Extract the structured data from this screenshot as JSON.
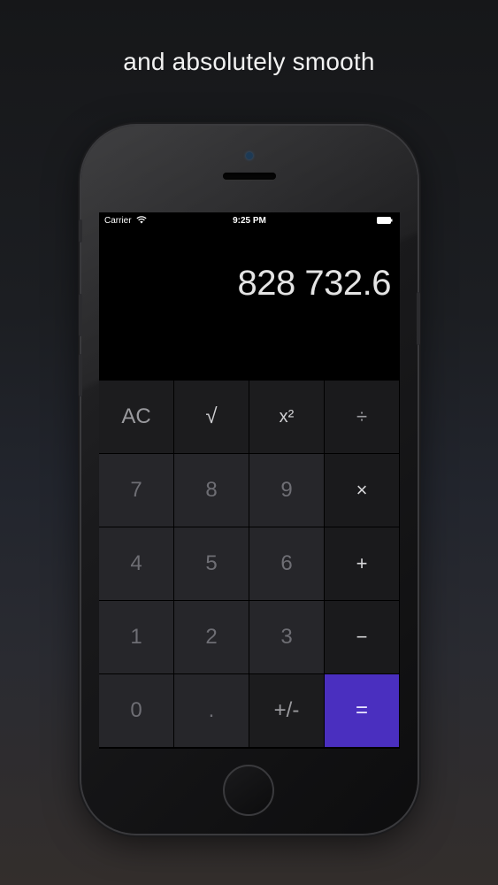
{
  "headline": "and absolutely smooth",
  "status_bar": {
    "carrier": "Carrier",
    "time": "9:25 PM"
  },
  "display": {
    "value": "828 732.6"
  },
  "keypad": {
    "keys": [
      {
        "label": "AC",
        "kind": "function"
      },
      {
        "label": "√",
        "kind": "function"
      },
      {
        "label": "x²",
        "kind": "function"
      },
      {
        "label": "÷",
        "kind": "operator"
      },
      {
        "label": "7",
        "kind": "digit"
      },
      {
        "label": "8",
        "kind": "digit"
      },
      {
        "label": "9",
        "kind": "digit"
      },
      {
        "label": "×",
        "kind": "operator"
      },
      {
        "label": "4",
        "kind": "digit"
      },
      {
        "label": "5",
        "kind": "digit"
      },
      {
        "label": "6",
        "kind": "digit"
      },
      {
        "label": "+",
        "kind": "operator"
      },
      {
        "label": "1",
        "kind": "digit"
      },
      {
        "label": "2",
        "kind": "digit"
      },
      {
        "label": "3",
        "kind": "digit"
      },
      {
        "label": "−",
        "kind": "operator"
      },
      {
        "label": "0",
        "kind": "digit"
      },
      {
        "label": ".",
        "kind": "digit"
      },
      {
        "label": "+/-",
        "kind": "function"
      },
      {
        "label": "=",
        "kind": "equals"
      }
    ]
  },
  "colors": {
    "equals_accent": "#4a2fbf",
    "display_text": "#e4e4e4"
  },
  "icons": {
    "wifi": "wifi-icon",
    "battery": "battery-icon"
  }
}
